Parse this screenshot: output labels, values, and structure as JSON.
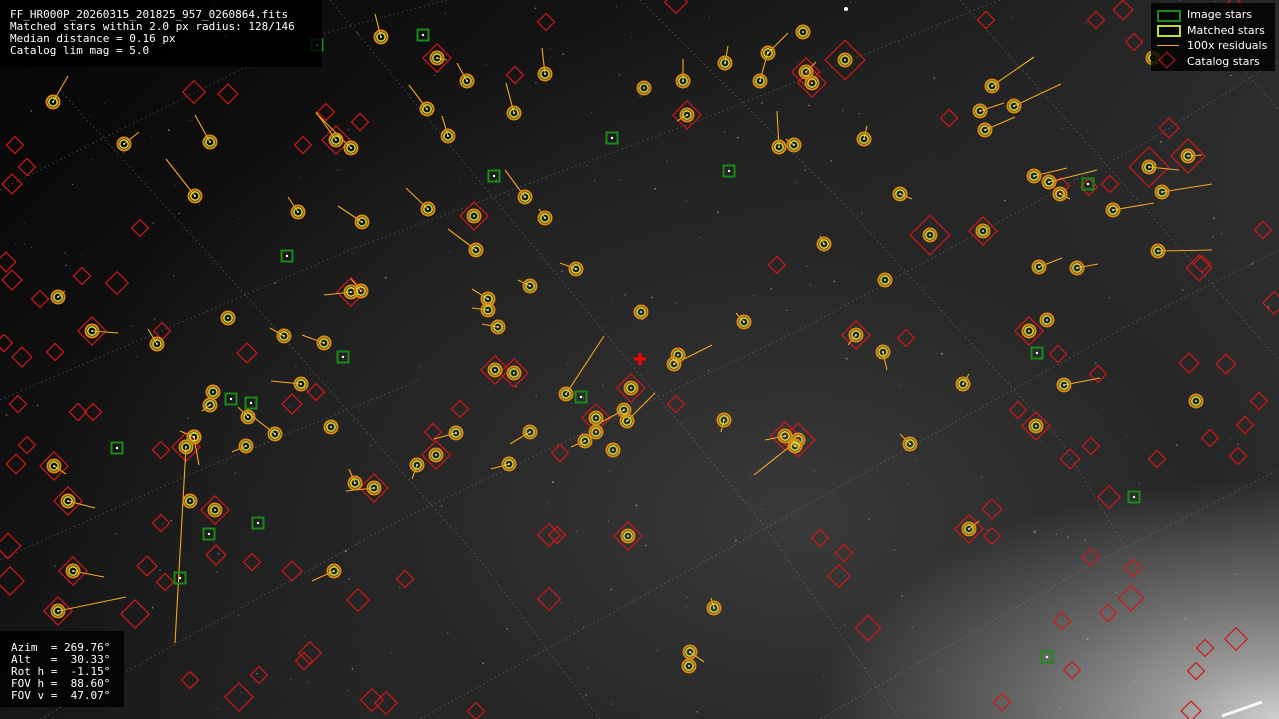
{
  "header": {
    "filename": "FF_HR000P_20260315_201825_957_0260864.fits",
    "matched_line": "Matched stars within 2.0 px radius: 128/146",
    "median_line": "Median distance = 0.16 px",
    "catalog_line": "Catalog lim mag = 5.0"
  },
  "pointing": {
    "azim": "Azim  = 269.76°",
    "alt": "Alt   =  30.33°",
    "roth": "Rot h =  -1.15°",
    "fovh": "FOV h =  88.60°",
    "fovv": "FOV v =  47.07°"
  },
  "legend": {
    "image_stars": "Image stars",
    "matched_stars": "Matched stars",
    "residuals": "100x residuals",
    "catalog_stars": "Catalog stars"
  },
  "colors": {
    "image_star": "#1a8a1a",
    "matched_outer": "#e08a10",
    "matched_inner": "#c8d83a",
    "residual": "#f5a623",
    "catalog": "#d01818",
    "center_marker": "#ff0000"
  },
  "icons": {
    "center": "red-cross-icon"
  }
}
